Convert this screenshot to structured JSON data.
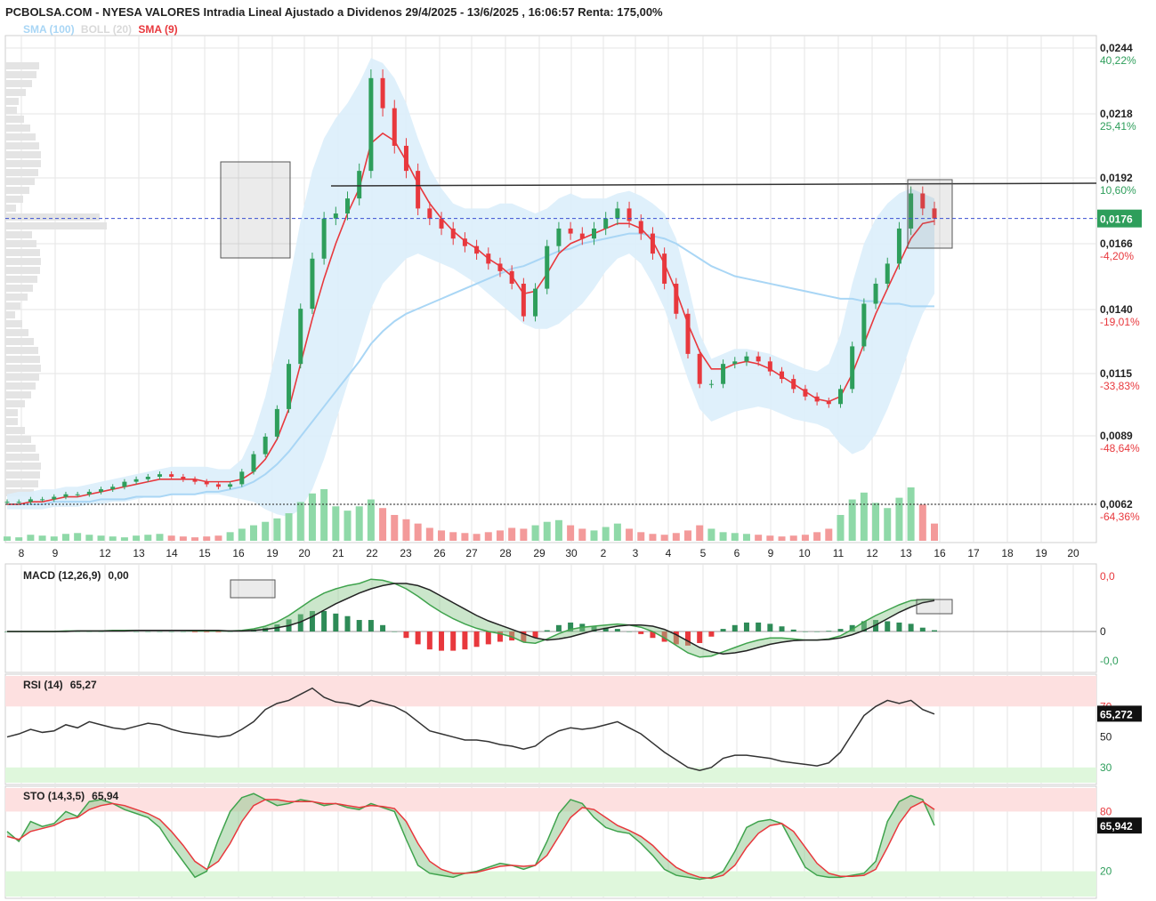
{
  "header": {
    "title": "PCBOLSA.COM - NYESA VALORES Intradia Lineal Ajustado a Dividenos 29/4/2025 - 13/6/2025 , 16:06:57 Renta: 175,00%"
  },
  "legend": [
    {
      "label": "SMA (100)",
      "color": "#a9d6f5"
    },
    {
      "label": "BOLL (20)",
      "color": "#d9d9d9"
    },
    {
      "label": "SMA (9)",
      "color": "#e8383d"
    }
  ],
  "colors": {
    "up": "#2e9e5b",
    "down": "#e8383d",
    "sma9": "#e8383d",
    "sma100": "#a9d6f5",
    "boll_fill": "#dbeefb",
    "grid": "#e6e6e6",
    "current_bg": "#2e9e5b",
    "pct_up": "#2e9e5b",
    "pct_down": "#e8383d",
    "macd_pos": "#2e8b57",
    "macd_neg": "#e8383d"
  },
  "chart_data": [
    {
      "panel": "price",
      "type": "candlestick",
      "x_labels": [
        "8",
        "9",
        "12",
        "13",
        "14",
        "15",
        "16",
        "19",
        "20",
        "21",
        "22",
        "23",
        "26",
        "27",
        "28",
        "29",
        "30",
        "2",
        "3",
        "4",
        "5",
        "6",
        "9",
        "10",
        "11",
        "12",
        "13",
        "16",
        "17",
        "18",
        "19",
        "20"
      ],
      "price_ticks": [
        {
          "value": "0,0244",
          "pct": "40,22%",
          "dir": "up"
        },
        {
          "value": "0,0218",
          "pct": "25,41%",
          "dir": "up"
        },
        {
          "value": "0,0192",
          "pct": "10,60%",
          "dir": "up"
        },
        {
          "value": "0,0166",
          "pct": "-4,20%",
          "dir": "down"
        },
        {
          "value": "0,0140",
          "pct": "-19,01%",
          "dir": "down"
        },
        {
          "value": "0,0115",
          "pct": "-33,83%",
          "dir": "down"
        },
        {
          "value": "0,0089",
          "pct": "-48,64%",
          "dir": "down"
        },
        {
          "value": "0,0062",
          "pct": "-64,36%",
          "dir": "down"
        }
      ],
      "y_range": [
        0.0062,
        0.0244
      ],
      "current_price": "0,0176",
      "current_value": 0.0176,
      "reference_price": 0.0062,
      "resistance_level": 0.0189,
      "close": [
        0.0063,
        0.0063,
        0.0064,
        0.0064,
        0.0065,
        0.0066,
        0.0066,
        0.0067,
        0.0068,
        0.0069,
        0.0071,
        0.0072,
        0.0073,
        0.0074,
        0.0073,
        0.0072,
        0.0071,
        0.007,
        0.0069,
        0.007,
        0.0075,
        0.0082,
        0.0089,
        0.01,
        0.0118,
        0.014,
        0.016,
        0.0176,
        0.0178,
        0.0184,
        0.0195,
        0.0232,
        0.022,
        0.0205,
        0.0195,
        0.018,
        0.0176,
        0.0172,
        0.0168,
        0.0165,
        0.0162,
        0.0158,
        0.0155,
        0.015,
        0.0137,
        0.0148,
        0.0165,
        0.0172,
        0.017,
        0.0168,
        0.0172,
        0.0176,
        0.018,
        0.0175,
        0.017,
        0.0162,
        0.015,
        0.0138,
        0.0122,
        0.011,
        0.011,
        0.0118,
        0.0119,
        0.0121,
        0.0119,
        0.0115,
        0.0112,
        0.0108,
        0.0105,
        0.0103,
        0.0102,
        0.0108,
        0.0125,
        0.0142,
        0.015,
        0.0158,
        0.0172,
        0.0186,
        0.018,
        0.0176
      ],
      "volume": [
        5,
        4,
        7,
        6,
        5,
        8,
        9,
        7,
        6,
        5,
        4,
        6,
        7,
        8,
        6,
        5,
        4,
        5,
        6,
        10,
        14,
        18,
        22,
        26,
        32,
        45,
        55,
        60,
        40,
        35,
        40,
        48,
        38,
        30,
        25,
        20,
        15,
        12,
        10,
        9,
        8,
        10,
        12,
        15,
        14,
        18,
        22,
        24,
        18,
        14,
        12,
        16,
        20,
        14,
        10,
        8,
        7,
        9,
        12,
        18,
        14,
        10,
        9,
        8,
        7,
        6,
        5,
        6,
        7,
        10,
        14,
        30,
        48,
        56,
        44,
        38,
        50,
        62,
        42,
        20
      ],
      "sma9": [
        0.0062,
        0.0062,
        0.0063,
        0.0063,
        0.0064,
        0.0065,
        0.0065,
        0.0066,
        0.0067,
        0.0068,
        0.0069,
        0.007,
        0.0071,
        0.0072,
        0.0072,
        0.0072,
        0.0072,
        0.0071,
        0.0071,
        0.0071,
        0.0072,
        0.0075,
        0.008,
        0.0088,
        0.01,
        0.0118,
        0.0136,
        0.0152,
        0.0166,
        0.0178,
        0.0188,
        0.0206,
        0.021,
        0.0207,
        0.0199,
        0.019,
        0.0182,
        0.0176,
        0.0171,
        0.0167,
        0.0164,
        0.016,
        0.0157,
        0.0153,
        0.0146,
        0.0147,
        0.0154,
        0.0162,
        0.0166,
        0.0168,
        0.017,
        0.0172,
        0.0174,
        0.0174,
        0.0172,
        0.0167,
        0.0158,
        0.0147,
        0.0134,
        0.0123,
        0.0116,
        0.0116,
        0.0118,
        0.0119,
        0.0118,
        0.0116,
        0.0113,
        0.011,
        0.0107,
        0.0104,
        0.0103,
        0.0105,
        0.0114,
        0.0126,
        0.0138,
        0.0148,
        0.0158,
        0.0168,
        0.0174,
        0.0175
      ],
      "sma100": [
        0.0062,
        0.0062,
        0.0062,
        0.0062,
        0.0063,
        0.0063,
        0.0063,
        0.0063,
        0.0064,
        0.0064,
        0.0064,
        0.0065,
        0.0065,
        0.0065,
        0.0066,
        0.0066,
        0.0066,
        0.0067,
        0.0067,
        0.0068,
        0.0069,
        0.0071,
        0.0074,
        0.0078,
        0.0083,
        0.0089,
        0.0095,
        0.0101,
        0.0107,
        0.0113,
        0.0119,
        0.0126,
        0.0131,
        0.0135,
        0.0138,
        0.014,
        0.0142,
        0.0144,
        0.0146,
        0.0148,
        0.015,
        0.0152,
        0.0154,
        0.0156,
        0.0157,
        0.0159,
        0.0161,
        0.0163,
        0.0164,
        0.0166,
        0.0167,
        0.0168,
        0.0169,
        0.017,
        0.017,
        0.0169,
        0.0168,
        0.0166,
        0.0163,
        0.016,
        0.0157,
        0.0155,
        0.0153,
        0.0152,
        0.0151,
        0.015,
        0.0149,
        0.0148,
        0.0147,
        0.0146,
        0.0145,
        0.0144,
        0.0144,
        0.0143,
        0.0143,
        0.0142,
        0.0142,
        0.0141,
        0.0141,
        0.0141
      ],
      "boll_upper": [
        0.0066,
        0.0067,
        0.0067,
        0.0068,
        0.0068,
        0.0069,
        0.0069,
        0.007,
        0.0071,
        0.0072,
        0.0073,
        0.0074,
        0.0075,
        0.0076,
        0.0077,
        0.0077,
        0.0077,
        0.0077,
        0.0076,
        0.0076,
        0.008,
        0.009,
        0.0105,
        0.0125,
        0.015,
        0.0175,
        0.0195,
        0.0208,
        0.0216,
        0.0222,
        0.023,
        0.024,
        0.0238,
        0.0232,
        0.0222,
        0.0208,
        0.0196,
        0.0188,
        0.0182,
        0.018,
        0.018,
        0.018,
        0.0182,
        0.0182,
        0.018,
        0.0178,
        0.018,
        0.0184,
        0.0186,
        0.0184,
        0.0184,
        0.0184,
        0.0186,
        0.0187,
        0.0185,
        0.0182,
        0.0178,
        0.0168,
        0.015,
        0.013,
        0.012,
        0.0122,
        0.0124,
        0.0124,
        0.0123,
        0.0122,
        0.012,
        0.0118,
        0.0116,
        0.0115,
        0.0118,
        0.013,
        0.015,
        0.0166,
        0.0176,
        0.0182,
        0.0186,
        0.0188,
        0.0186,
        0.0184
      ],
      "boll_lower": [
        0.006,
        0.006,
        0.006,
        0.006,
        0.0061,
        0.0061,
        0.0061,
        0.0062,
        0.0062,
        0.0063,
        0.0063,
        0.0064,
        0.0065,
        0.0065,
        0.0066,
        0.0066,
        0.0066,
        0.0066,
        0.0066,
        0.0065,
        0.0064,
        0.0063,
        0.006,
        0.0058,
        0.0057,
        0.006,
        0.0068,
        0.008,
        0.0095,
        0.011,
        0.0125,
        0.014,
        0.015,
        0.0155,
        0.016,
        0.0162,
        0.016,
        0.0158,
        0.0156,
        0.0153,
        0.015,
        0.0146,
        0.0142,
        0.0138,
        0.0134,
        0.0132,
        0.0132,
        0.0134,
        0.0138,
        0.0142,
        0.0148,
        0.0155,
        0.016,
        0.0162,
        0.0158,
        0.015,
        0.014,
        0.0126,
        0.0112,
        0.01,
        0.0095,
        0.0097,
        0.0099,
        0.01,
        0.0101,
        0.01,
        0.0098,
        0.0096,
        0.0095,
        0.0094,
        0.0092,
        0.0086,
        0.0082,
        0.0084,
        0.009,
        0.01,
        0.0112,
        0.0126,
        0.0138,
        0.0146
      ]
    },
    {
      "panel": "macd",
      "type": "line",
      "label": "MACD (12,26,9)",
      "value": "0,00",
      "ticks": [
        "0,0",
        "0",
        "-0,0"
      ],
      "macd": [
        0,
        0,
        0,
        0,
        0,
        0.01,
        0.01,
        0.01,
        0.01,
        0.02,
        0.02,
        0.02,
        0.02,
        0.02,
        0.02,
        0.02,
        0.01,
        0.01,
        0.01,
        0.01,
        0.02,
        0.05,
        0.1,
        0.18,
        0.3,
        0.45,
        0.6,
        0.72,
        0.8,
        0.86,
        0.9,
        0.98,
        0.96,
        0.9,
        0.8,
        0.66,
        0.5,
        0.36,
        0.24,
        0.14,
        0.06,
        0,
        -0.04,
        -0.1,
        -0.2,
        -0.22,
        -0.14,
        -0.04,
        0.04,
        0.08,
        0.1,
        0.12,
        0.14,
        0.12,
        0.08,
        0,
        -0.12,
        -0.26,
        -0.4,
        -0.48,
        -0.46,
        -0.38,
        -0.3,
        -0.22,
        -0.16,
        -0.12,
        -0.12,
        -0.14,
        -0.16,
        -0.16,
        -0.14,
        -0.08,
        0.04,
        0.18,
        0.3,
        0.4,
        0.5,
        0.58,
        0.6,
        0.6
      ],
      "signal": [
        0,
        0,
        0,
        0,
        0,
        0,
        0.01,
        0.01,
        0.01,
        0.01,
        0.01,
        0.02,
        0.02,
        0.02,
        0.02,
        0.02,
        0.02,
        0.02,
        0.02,
        0.01,
        0.01,
        0.02,
        0.04,
        0.07,
        0.11,
        0.18,
        0.28,
        0.4,
        0.52,
        0.62,
        0.72,
        0.8,
        0.86,
        0.9,
        0.9,
        0.86,
        0.78,
        0.66,
        0.54,
        0.42,
        0.3,
        0.2,
        0.12,
        0.04,
        -0.04,
        -0.12,
        -0.16,
        -0.14,
        -0.1,
        -0.04,
        0.02,
        0.06,
        0.1,
        0.12,
        0.12,
        0.1,
        0.04,
        -0.06,
        -0.18,
        -0.3,
        -0.38,
        -0.42,
        -0.4,
        -0.36,
        -0.3,
        -0.24,
        -0.2,
        -0.17,
        -0.16,
        -0.16,
        -0.15,
        -0.12,
        -0.06,
        0.02,
        0.12,
        0.24,
        0.36,
        0.46,
        0.54,
        0.58
      ]
    },
    {
      "panel": "rsi",
      "type": "line",
      "label": "RSI (14)",
      "value": "65,27",
      "current": "65,272",
      "ticks": [
        "70",
        "50",
        "30"
      ],
      "y_range": [
        20,
        90
      ],
      "values": [
        50,
        52,
        55,
        53,
        54,
        58,
        56,
        60,
        58,
        56,
        55,
        57,
        59,
        58,
        55,
        53,
        52,
        51,
        50,
        51,
        55,
        60,
        68,
        72,
        74,
        78,
        82,
        76,
        73,
        72,
        70,
        74,
        72,
        70,
        66,
        60,
        54,
        52,
        50,
        48,
        48,
        47,
        45,
        44,
        42,
        44,
        50,
        54,
        56,
        55,
        56,
        58,
        60,
        56,
        52,
        46,
        40,
        35,
        30,
        28,
        30,
        36,
        38,
        38,
        37,
        36,
        34,
        33,
        32,
        31,
        33,
        40,
        52,
        64,
        70,
        74,
        72,
        74,
        68,
        65
      ]
    },
    {
      "panel": "sto",
      "type": "line",
      "label": "STO (14,3,5)",
      "value": "65,94",
      "current": "65,942",
      "ticks": [
        "80",
        "20"
      ],
      "y_range": [
        0,
        100
      ],
      "k": [
        60,
        50,
        70,
        65,
        68,
        80,
        75,
        90,
        92,
        88,
        82,
        78,
        74,
        64,
        46,
        30,
        14,
        20,
        52,
        80,
        94,
        98,
        92,
        86,
        88,
        92,
        90,
        86,
        88,
        84,
        82,
        88,
        84,
        80,
        52,
        26,
        18,
        16,
        14,
        18,
        20,
        24,
        28,
        26,
        22,
        26,
        50,
        78,
        92,
        88,
        74,
        64,
        60,
        58,
        48,
        36,
        22,
        16,
        14,
        12,
        14,
        20,
        40,
        64,
        70,
        72,
        68,
        46,
        24,
        16,
        14,
        14,
        16,
        18,
        30,
        70,
        90,
        96,
        92,
        66
      ],
      "d": [
        55,
        52,
        60,
        63,
        66,
        72,
        74,
        82,
        86,
        88,
        86,
        82,
        78,
        72,
        60,
        46,
        30,
        22,
        30,
        48,
        70,
        86,
        92,
        92,
        90,
        90,
        90,
        88,
        88,
        86,
        84,
        86,
        85,
        83,
        70,
        48,
        30,
        22,
        18,
        18,
        19,
        22,
        25,
        26,
        25,
        26,
        36,
        55,
        74,
        84,
        82,
        74,
        66,
        61,
        55,
        46,
        34,
        24,
        18,
        14,
        13,
        16,
        26,
        44,
        58,
        66,
        68,
        60,
        44,
        28,
        18,
        15,
        15,
        16,
        22,
        44,
        68,
        84,
        90,
        82
      ]
    }
  ]
}
